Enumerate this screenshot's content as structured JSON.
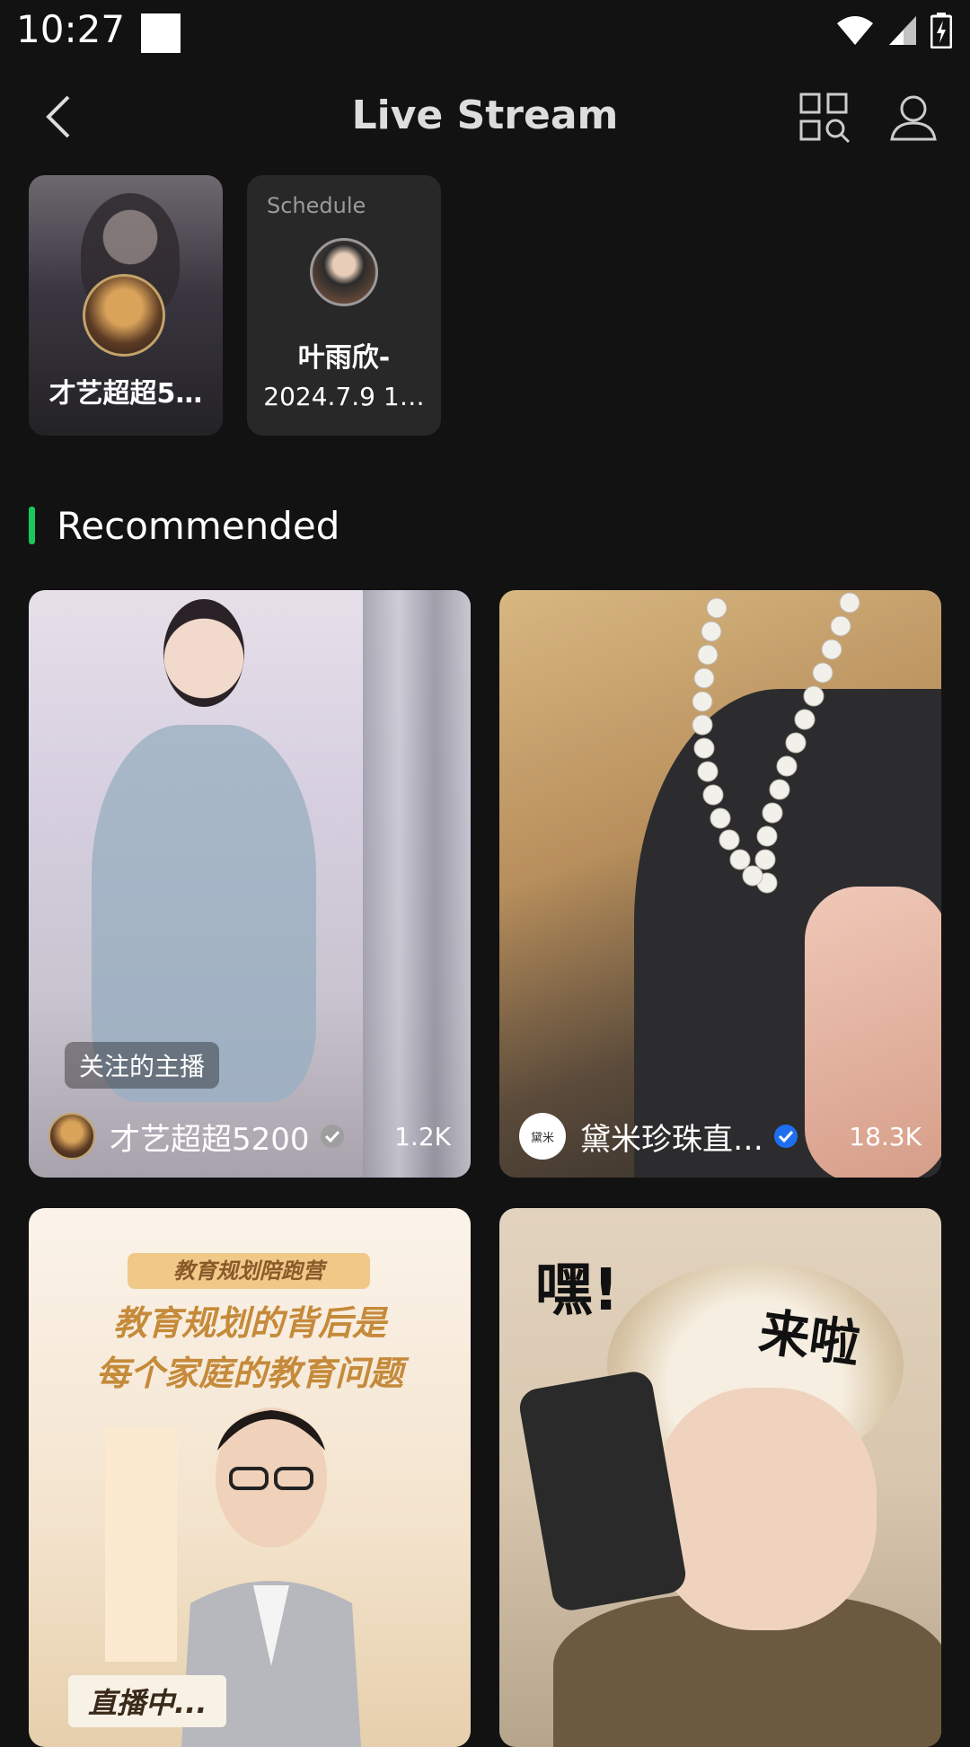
{
  "status_bar": {
    "time": "10:27"
  },
  "header": {
    "title": "Live Stream"
  },
  "live_now": [
    {
      "name": "才艺超超5…"
    },
    {
      "schedule_label": "Schedule",
      "name": "叶雨欣-",
      "subtitle": "2024.7.9 1…"
    }
  ],
  "section": {
    "title": "Recommended"
  },
  "recommended": [
    {
      "tag": "关注的主播",
      "name": "才艺超超5200",
      "viewers": "1.2K",
      "verify_color": "#9e9e9e"
    },
    {
      "name": "黛米珍珠直…",
      "viewers": "18.3K",
      "verify_color": "#1e6ff0",
      "avatar_text": "黛米"
    },
    {
      "banner": "教育规划陪跑营",
      "headline_1": "教育规划的背后是",
      "headline_2": "每个家庭的教育问题",
      "badge": "直播中..."
    },
    {
      "text_1": "嘿!",
      "text_2": "来啦"
    }
  ],
  "colors": {
    "accent": "#18c85a",
    "background": "#121212"
  }
}
